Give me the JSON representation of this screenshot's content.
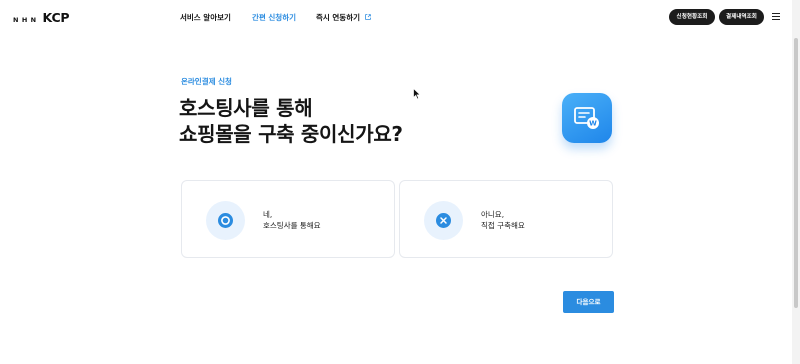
{
  "header": {
    "logo_prefix": "NHN",
    "logo_brand": "KCP",
    "nav": [
      {
        "label": "서비스 알아보기"
      },
      {
        "label": "간편 신청하기"
      },
      {
        "label": "즉시 연동하기"
      }
    ],
    "buttons": {
      "apply_status": "신청현황조회",
      "payment_history": "결제내역조회"
    }
  },
  "main": {
    "eyebrow": "온라인결제 신청",
    "title_line1": "호스팅사를 통해",
    "title_line2": "쇼핑몰을 구축 중이신가요?",
    "options": [
      {
        "line1": "네,",
        "line2": "호스팅사를 통해요"
      },
      {
        "line1": "아니요,",
        "line2": "직접 구축해요"
      }
    ],
    "next_label": "다음으로"
  },
  "colors": {
    "accent": "#2b8ce0",
    "dark_button": "#1c1c1c",
    "option_bg_circle": "#e8f2fd"
  },
  "icons": {
    "hero": "payment-card-icon",
    "option_yes": "circle-icon",
    "option_no": "x-icon",
    "nav_external": "external-link-icon",
    "menu": "hamburger-icon"
  }
}
